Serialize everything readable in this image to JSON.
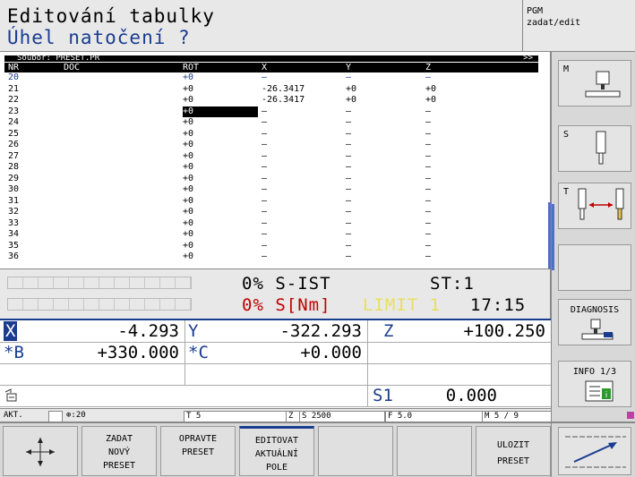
{
  "header": {
    "title": "Editování tabulky",
    "subtitle": "Úhel natočení ?",
    "mode_line1": "PGM",
    "mode_line2": "zadat/edit"
  },
  "table": {
    "file_label": "Soubor: PRESET.PR",
    "more_indicator": ">>",
    "columns": [
      "NR",
      "DOC",
      "ROT",
      "X",
      "Y",
      "Z"
    ],
    "rows": [
      {
        "nr": "20",
        "doc": "",
        "rot": "+0",
        "x": "–",
        "y": "–",
        "z": "–"
      },
      {
        "nr": "21",
        "doc": "",
        "rot": "+0",
        "x": "-26.3417",
        "y": "+0",
        "z": "+0"
      },
      {
        "nr": "22",
        "doc": "",
        "rot": "+0",
        "x": "-26.3417",
        "y": "+0",
        "z": "+0"
      },
      {
        "nr": "23",
        "doc": "",
        "rot": "+0",
        "x": "–",
        "y": "–",
        "z": "–"
      },
      {
        "nr": "24",
        "doc": "",
        "rot": "+0",
        "x": "–",
        "y": "–",
        "z": "–"
      },
      {
        "nr": "25",
        "doc": "",
        "rot": "+0",
        "x": "–",
        "y": "–",
        "z": "–"
      },
      {
        "nr": "26",
        "doc": "",
        "rot": "+0",
        "x": "–",
        "y": "–",
        "z": "–"
      },
      {
        "nr": "27",
        "doc": "",
        "rot": "+0",
        "x": "–",
        "y": "–",
        "z": "–"
      },
      {
        "nr": "28",
        "doc": "",
        "rot": "+0",
        "x": "–",
        "y": "–",
        "z": "–"
      },
      {
        "nr": "29",
        "doc": "",
        "rot": "+0",
        "x": "–",
        "y": "–",
        "z": "–"
      },
      {
        "nr": "30",
        "doc": "",
        "rot": "+0",
        "x": "–",
        "y": "–",
        "z": "–"
      },
      {
        "nr": "31",
        "doc": "",
        "rot": "+0",
        "x": "–",
        "y": "–",
        "z": "–"
      },
      {
        "nr": "32",
        "doc": "",
        "rot": "+0",
        "x": "–",
        "y": "–",
        "z": "–"
      },
      {
        "nr": "33",
        "doc": "",
        "rot": "+0",
        "x": "–",
        "y": "–",
        "z": "–"
      },
      {
        "nr": "34",
        "doc": "",
        "rot": "+0",
        "x": "–",
        "y": "–",
        "z": "–"
      },
      {
        "nr": "35",
        "doc": "",
        "rot": "+0",
        "x": "–",
        "y": "–",
        "z": "–"
      },
      {
        "nr": "36",
        "doc": "",
        "rot": "+0",
        "x": "–",
        "y": "–",
        "z": "–"
      }
    ]
  },
  "status": {
    "s_ist": "0% S-IST",
    "st": "ST:1",
    "s_nm": "0% S[Nm]",
    "limit": "LIMIT 1",
    "time": "17:15"
  },
  "positions": {
    "x_label": "X",
    "x_value": "-4.293",
    "y_label": "Y",
    "y_value": "-322.293",
    "z_label": "Z",
    "z_value": "+100.250",
    "b_label": "*B",
    "b_value": "+330.000",
    "c_label": "*C",
    "c_value": "+0.000",
    "s1_label": "S1",
    "s1_value": "0.000"
  },
  "infoline": {
    "akt": "AKT.",
    "tool_axis": "⊕:20",
    "t": "T 5",
    "z": "Z",
    "s": "S 2500",
    "f": "F 5.0",
    "m": "M 5 / 9"
  },
  "softkeys": [
    {
      "label": ""
    },
    {
      "label": "ZADAT\nNOVÝ\nPRESET"
    },
    {
      "label": "OPRAVTE\nPRESET"
    },
    {
      "label": "EDITOVAT\nAKTUÁLNÍ\nPOLE"
    },
    {
      "label": ""
    },
    {
      "label": ""
    },
    {
      "label": "ULOZIT\nPRESET"
    }
  ],
  "right_softkeys": {
    "m": "M",
    "s": "S",
    "t": "T",
    "diagnosis": "DIAGNOSIS",
    "info": "INFO 1/3"
  },
  "colors": {
    "accent": "#1a3c8f",
    "alert": "#c00000",
    "limit": "#e8e060"
  }
}
